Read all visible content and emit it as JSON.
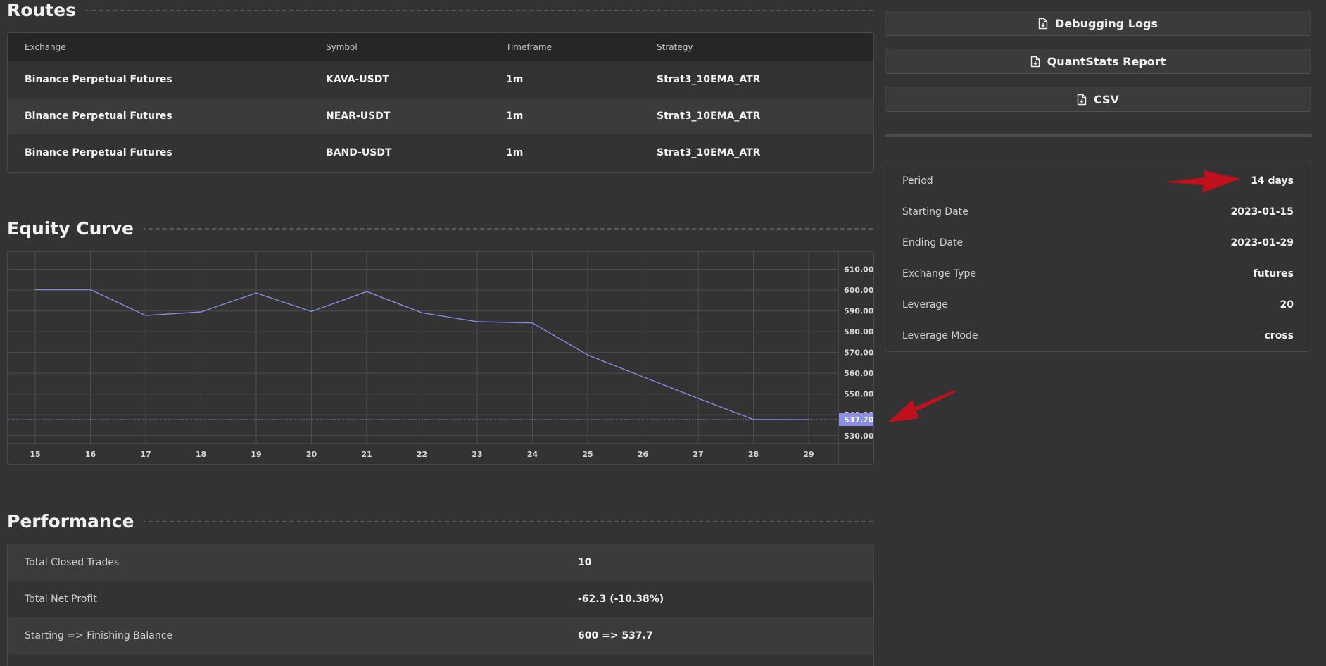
{
  "routes": {
    "title": "Routes",
    "columns": [
      "Exchange",
      "Symbol",
      "Timeframe",
      "Strategy"
    ],
    "rows": [
      [
        "Binance Perpetual Futures",
        "KAVA-USDT",
        "1m",
        "Strat3_10EMA_ATR"
      ],
      [
        "Binance Perpetual Futures",
        "NEAR-USDT",
        "1m",
        "Strat3_10EMA_ATR"
      ],
      [
        "Binance Perpetual Futures",
        "BAND-USDT",
        "1m",
        "Strat3_10EMA_ATR"
      ]
    ]
  },
  "equity": {
    "title": "Equity Curve"
  },
  "chart_data": {
    "type": "line",
    "title": "",
    "xlabel": "",
    "ylabel": "",
    "x": [
      "15",
      "16",
      "17",
      "18",
      "19",
      "20",
      "21",
      "22",
      "23",
      "24",
      "25",
      "26",
      "27",
      "28",
      "29"
    ],
    "series": [
      {
        "values": [
          600.2,
          600.2,
          587.8,
          589.5,
          598.6,
          589.7,
          599.3,
          589.1,
          584.8,
          584.2,
          568.8,
          558.3,
          547.9,
          537.8,
          537.7
        ]
      }
    ],
    "yticks": [
      "610.00",
      "600.00",
      "590.00",
      "580.00",
      "570.00",
      "560.00",
      "550.00",
      "540.00",
      "530.00"
    ],
    "ylim": [
      526.2,
      618.3
    ],
    "last_value_label": "537.70",
    "grid": true,
    "line_color": "#8b8fe8"
  },
  "performance": {
    "title": "Performance",
    "rows": [
      {
        "label": "Total Closed Trades",
        "value": "10"
      },
      {
        "label": "Total Net Profit",
        "value": "-62.3 (-10.38%)"
      },
      {
        "label": "Starting => Finishing Balance",
        "value": "600 => 537.7"
      }
    ]
  },
  "actions": {
    "debug_logs": "Debugging Logs",
    "quantstats": "QuantStats Report",
    "csv": "CSV"
  },
  "info": [
    {
      "label": "Period",
      "value": "14 days"
    },
    {
      "label": "Starting Date",
      "value": "2023-01-15"
    },
    {
      "label": "Ending Date",
      "value": "2023-01-29"
    },
    {
      "label": "Exchange Type",
      "value": "futures"
    },
    {
      "label": "Leverage",
      "value": "20"
    },
    {
      "label": "Leverage Mode",
      "value": "cross"
    }
  ],
  "colors": {
    "background": "#333333",
    "annotation_arrow": "#c0101c",
    "chart_line": "#8b8fe8"
  },
  "icons": [
    "file-download-icon",
    "red-arrow-annotation"
  ]
}
